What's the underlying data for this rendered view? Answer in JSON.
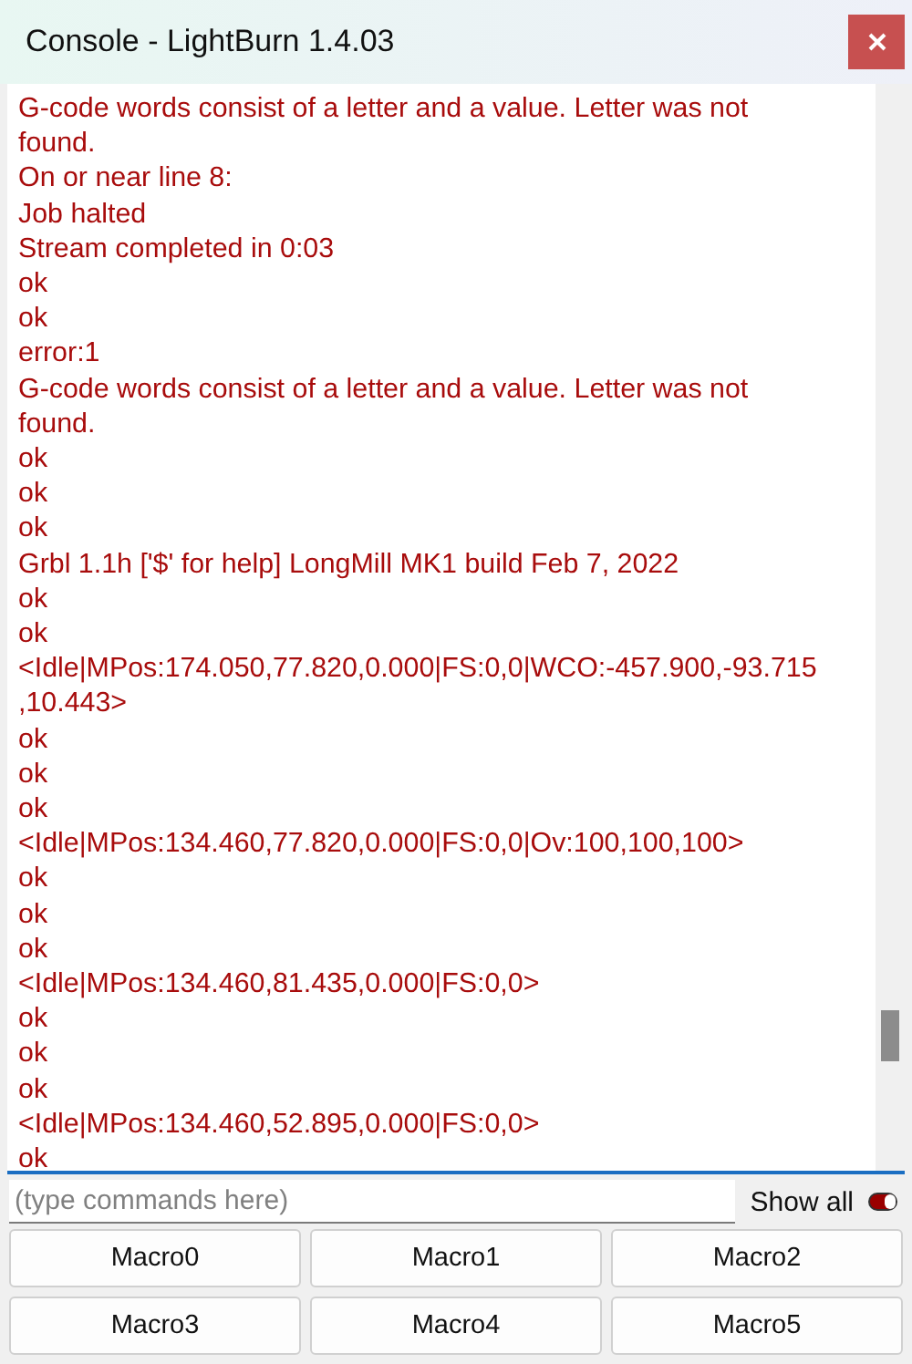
{
  "window": {
    "title": "Console - LightBurn 1.4.03"
  },
  "console_lines": [
    "G-code words consist of a letter and a value. Letter was not found.",
    "On or near line 8:",
    "Job halted",
    "Stream completed in 0:03",
    "ok",
    "ok",
    "error:1",
    "G-code words consist of a letter and a value. Letter was not found.",
    "ok",
    "ok",
    "ok",
    "Grbl 1.1h ['$' for help] LongMill MK1 build Feb 7, 2022",
    "ok",
    "ok",
    "<Idle|MPos:174.050,77.820,0.000|FS:0,0|WCO:-457.900,-93.715,10.443>",
    "ok",
    "ok",
    "ok",
    "<Idle|MPos:134.460,77.820,0.000|FS:0,0|Ov:100,100,100>",
    "ok",
    "ok",
    "ok",
    "<Idle|MPos:134.460,81.435,0.000|FS:0,0>",
    "ok",
    "ok",
    "ok",
    "<Idle|MPos:134.460,52.895,0.000|FS:0,0>",
    "ok"
  ],
  "command_input": {
    "placeholder": "(type commands here)"
  },
  "show_all": {
    "label": "Show all",
    "on": true
  },
  "macros": [
    "Macro0",
    "Macro1",
    "Macro2",
    "Macro3",
    "Macro4",
    "Macro5"
  ]
}
